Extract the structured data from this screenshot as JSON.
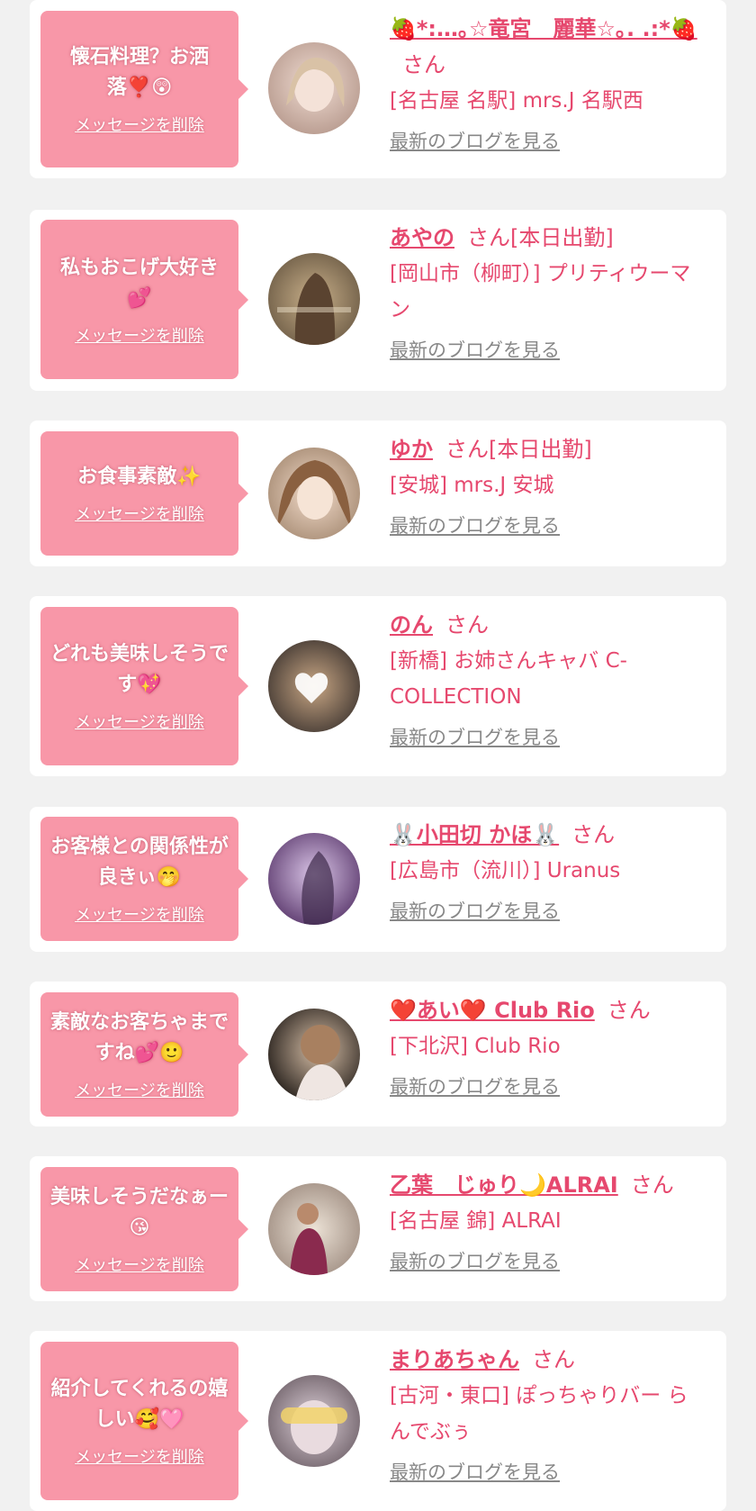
{
  "delete_label": "メッセージを削除",
  "blog_label": "最新のブログを見る",
  "san_label": "さん",
  "colors": {
    "page_bg": "#f1f1f1",
    "bubble": "#f897a8",
    "accent": "#e6486e",
    "link_gray": "#888888"
  },
  "items": [
    {
      "message": "懐石料理？お洒落❣️😲",
      "name": "🍓*:…｡☆竜宮　麗華☆｡. .:*🍓",
      "suffix": "さん",
      "store": "[名古屋 名駅] mrs.J 名駅西"
    },
    {
      "message": "私もおこげ大好き💕",
      "name": "あやの",
      "suffix": "さん[本日出勤]",
      "store": "[岡山市（柳町）] プリティウーマン"
    },
    {
      "message": "お食事素敵✨",
      "name": "ゆか",
      "suffix": "さん[本日出勤]",
      "store": "[安城] mrs.J 安城"
    },
    {
      "message": "どれも美味しそうです💖",
      "name": "のん",
      "suffix": "さん",
      "store": "[新橋] お姉さんキャバ C-COLLECTION"
    },
    {
      "message": "お客様との関係性が良きぃ🤭",
      "name": "🐰小田切 かほ🐰",
      "suffix": "さん",
      "store": "[広島市（流川）] Uranus"
    },
    {
      "message": "素敵なお客ちゃまですね💕🙂",
      "name": "❤️あい❤️ Club Rio",
      "suffix": "さん",
      "store": "[下北沢] Club Rio"
    },
    {
      "message": "美味しそうだなぁー😘",
      "name": "乙葉　じゅり🌙ALRAI",
      "suffix": "さん",
      "store": "[名古屋 錦] ALRAI"
    },
    {
      "message": "紹介してくれるの嬉しい🥰🩷",
      "name": "まりあちゃん",
      "suffix": "さん",
      "store": "[古河・東口] ぽっちゃりバー らんでぶぅ"
    }
  ]
}
